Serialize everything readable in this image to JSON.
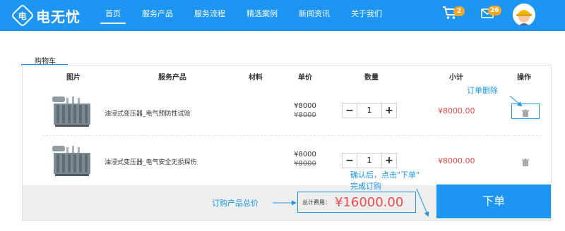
{
  "header": {
    "logo_text": "电无忧",
    "logo_mark": "电",
    "nav": [
      "首页",
      "服务产品",
      "服务流程",
      "精选案例",
      "新闻资讯",
      "关于我们"
    ],
    "cart_count": "2",
    "message_count": "26"
  },
  "cart": {
    "tab": "购物车",
    "columns": {
      "image": "图片",
      "product": "服务产品",
      "material": "材料",
      "unit_price": "单价",
      "quantity": "数量",
      "subtotal": "小计",
      "action": "操作"
    },
    "items": [
      {
        "name": "油浸式变压器_电气预防性试验",
        "price": "¥8000",
        "old_price": "¥8000",
        "qty": "1",
        "subtotal": "¥8000.00"
      },
      {
        "name": "油浸式变压器_电气安全无损探伤",
        "price": "¥8000",
        "old_price": "¥8000",
        "qty": "1",
        "subtotal": "¥8000.00"
      }
    ],
    "stepper": {
      "minus": "−",
      "plus": "+"
    },
    "total_label": "总计费用：",
    "total_value": "¥16000.00",
    "submit_label": "下单"
  },
  "annotations": {
    "delete_order": "订单删除",
    "confirm_line1": "确认后，点击\"下单\"",
    "confirm_line2": "完成订购",
    "total_price": "订购产品总价"
  },
  "colors": {
    "brand": "#1c96f2",
    "price_red": "#ef4a4a",
    "badge": "#f5a623"
  },
  "icons": [
    "cart-icon",
    "mail-icon",
    "avatar",
    "trash-icon"
  ]
}
